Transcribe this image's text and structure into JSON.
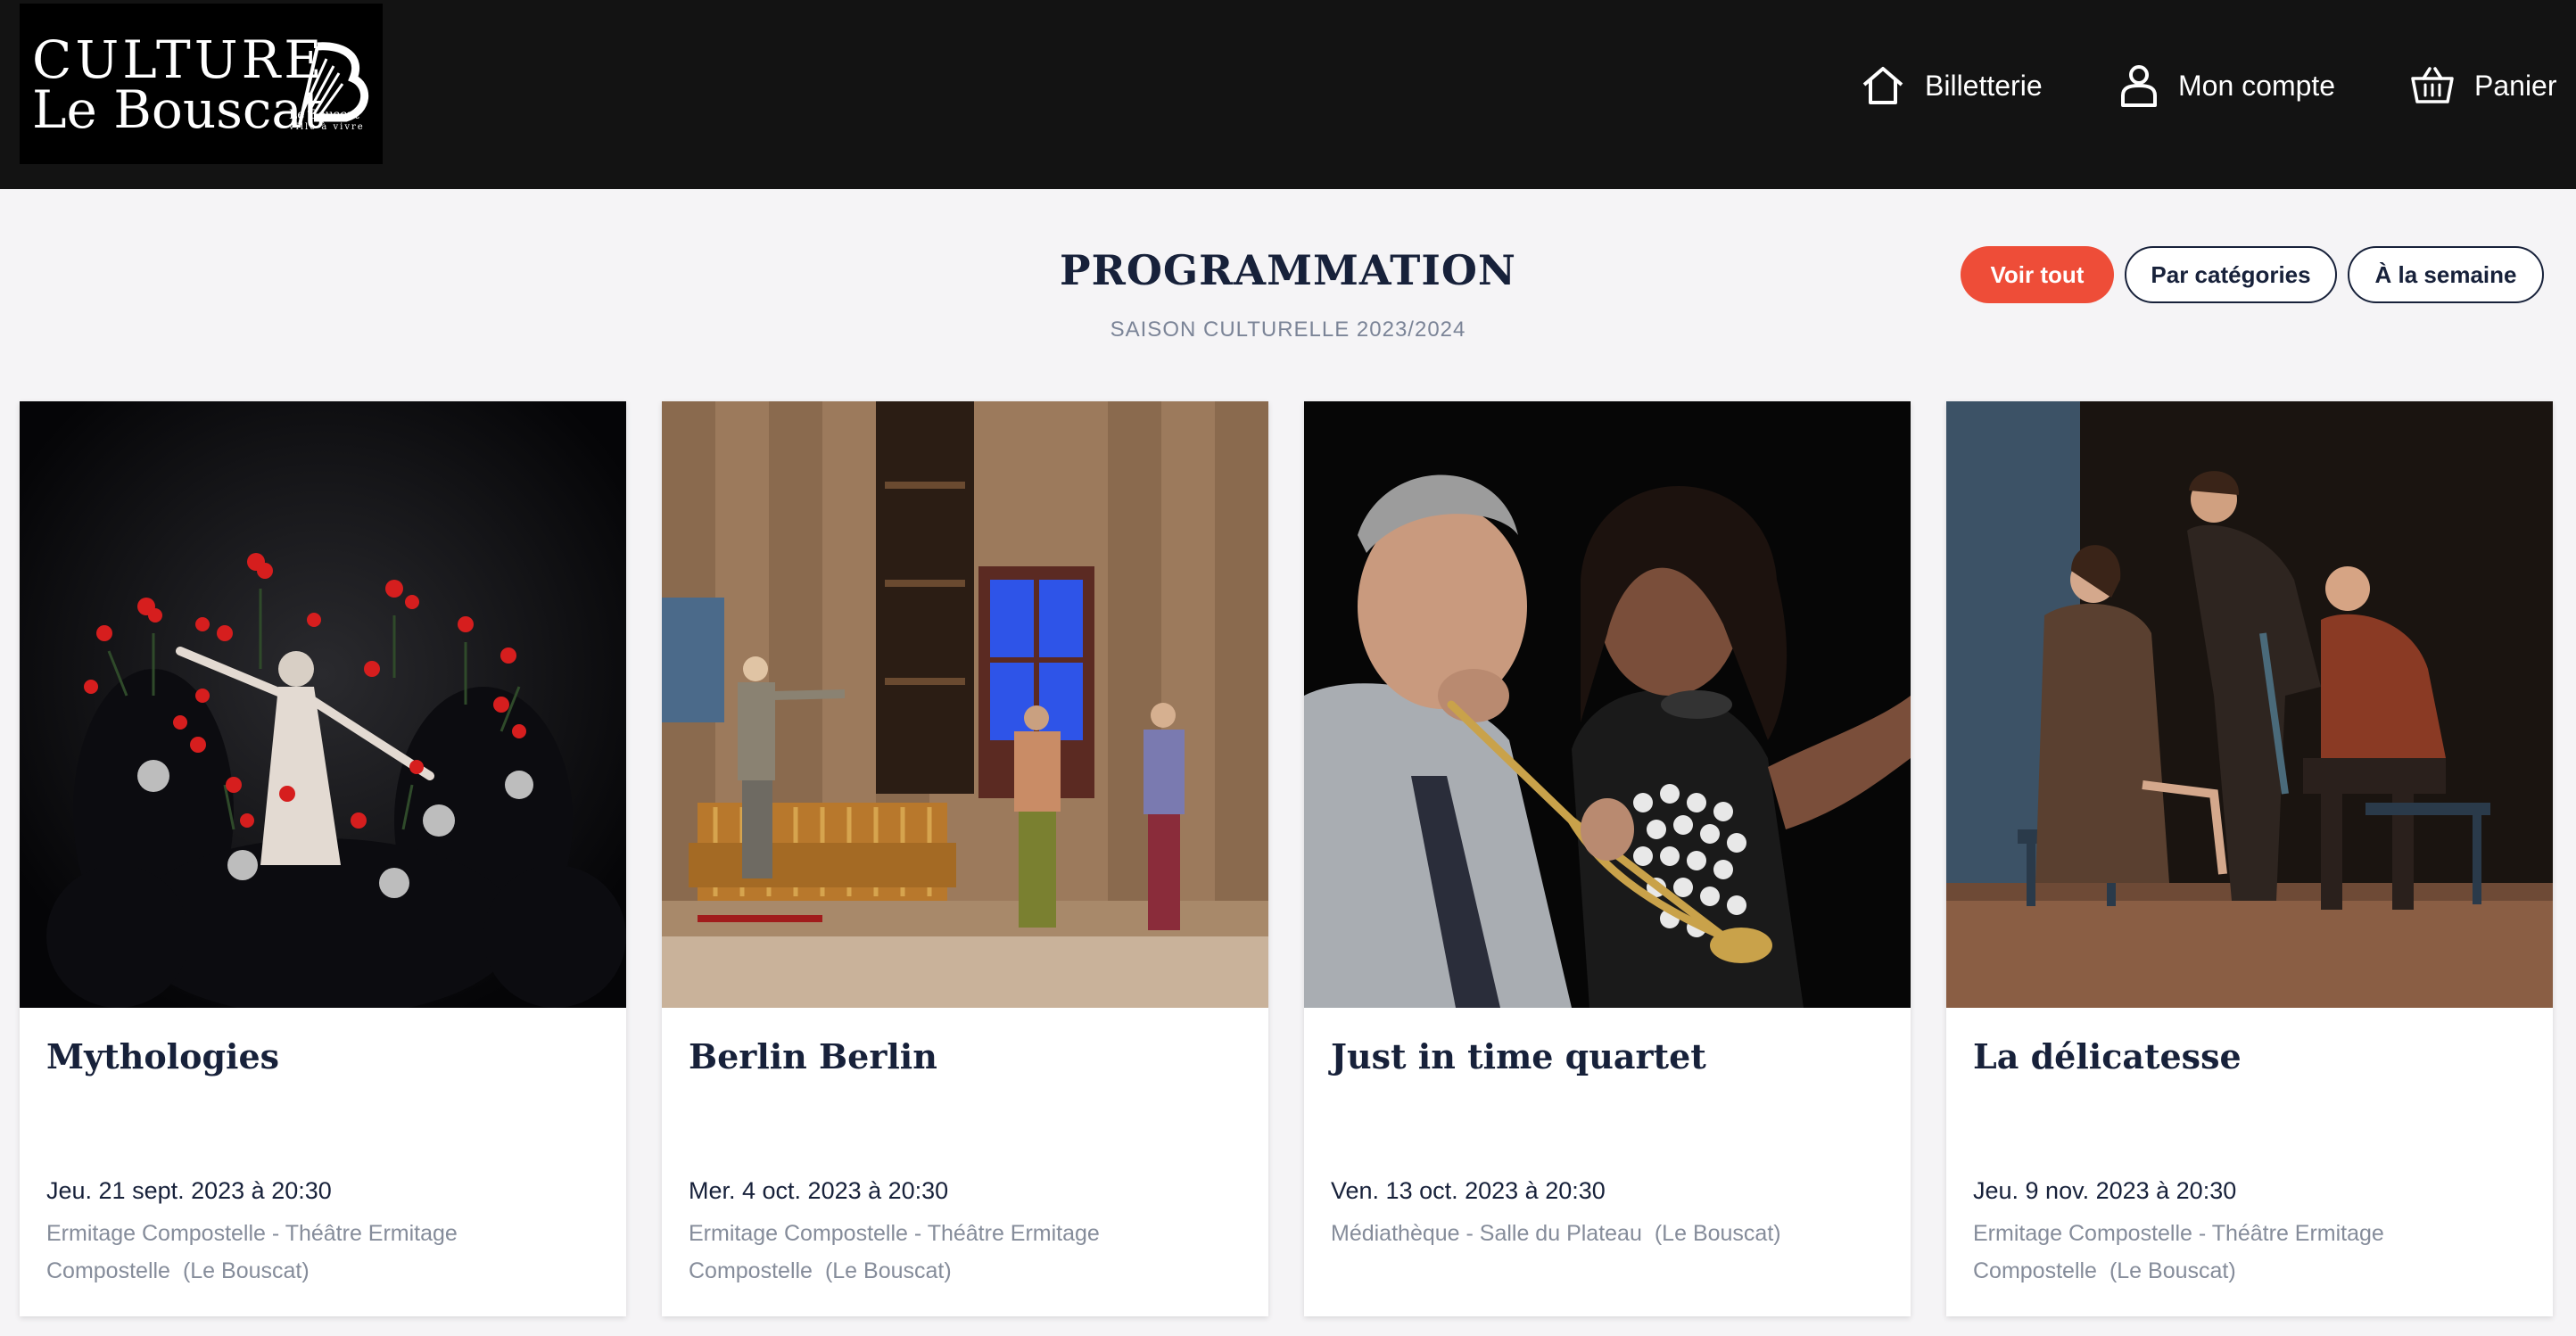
{
  "header": {
    "logo": {
      "line1": "CULTURE",
      "line2": "Le Bouscat",
      "mark_text_1": "Le Bouscat",
      "mark_text_2": "ville à vivre"
    },
    "nav": [
      {
        "label": "Billetterie",
        "icon": "home-icon"
      },
      {
        "label": "Mon compte",
        "icon": "user-icon"
      },
      {
        "label": "Panier",
        "icon": "basket-icon"
      }
    ]
  },
  "page": {
    "title": "PROGRAMMATION",
    "subtitle": "SAISON CULTURELLE 2023/2024"
  },
  "filters": {
    "all": "Voir tout",
    "categories": "Par catégories",
    "week": "À la semaine",
    "active": "all"
  },
  "events": [
    {
      "title": "Mythologies",
      "date": "Jeu. 21 sept. 2023 à 20:30",
      "venue": "Ermitage Compostelle - Théâtre Ermitage Compostelle",
      "city": "(Le Bouscat)"
    },
    {
      "title": "Berlin Berlin",
      "date": "Mer. 4 oct. 2023 à 20:30",
      "venue": "Ermitage Compostelle - Théâtre Ermitage Compostelle",
      "city": "(Le Bouscat)"
    },
    {
      "title": "Just in time quartet",
      "date": "Ven. 13 oct. 2023 à 20:30",
      "venue": "Médiathèque - Salle du Plateau",
      "city": "(Le Bouscat)"
    },
    {
      "title": "La délicatesse",
      "date": "Jeu. 9 nov. 2023 à 20:30",
      "venue": "Ermitage Compostelle - Théâtre Ermitage Compostelle",
      "city": "(Le Bouscat)"
    }
  ],
  "colors": {
    "header_bg": "#131313",
    "page_bg": "#f5f4f6",
    "accent": "#ee4d38",
    "navy": "#17213a",
    "muted": "#858c9a"
  }
}
